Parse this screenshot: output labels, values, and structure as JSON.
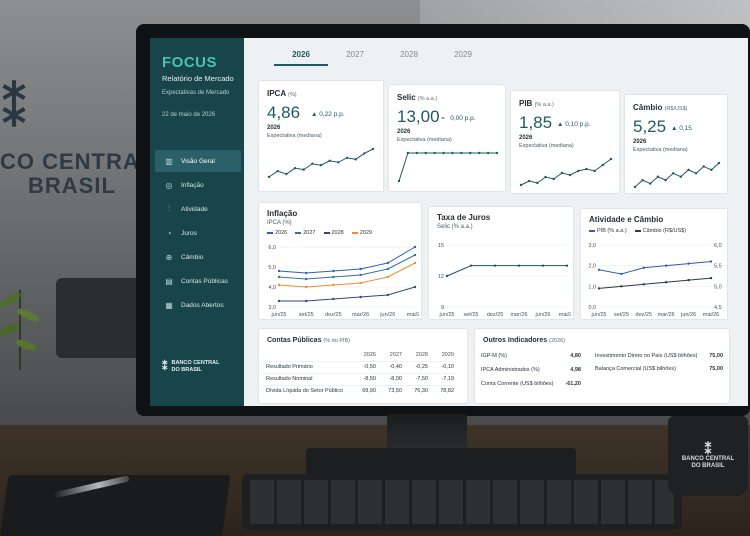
{
  "sidebar": {
    "brand": "FOCUS",
    "subtitle": "Relatório de Mercado",
    "description": "Expectativas de Mercado",
    "date": "22 de maio de 2026",
    "items": [
      {
        "label": "Visão Geral",
        "icon": "bar-chart-icon",
        "glyph": "▥",
        "active": true
      },
      {
        "label": "Inflação",
        "icon": "percent-icon",
        "glyph": "◎",
        "active": false
      },
      {
        "label": "Atividade",
        "icon": "activity-icon",
        "glyph": "⫶",
        "active": false
      },
      {
        "label": "Juros",
        "icon": "interest-icon",
        "glyph": "◔",
        "active": false
      },
      {
        "label": "Câmbio",
        "icon": "exchange-icon",
        "glyph": "⊕",
        "active": false
      },
      {
        "label": "Contas Públicas",
        "icon": "ledger-icon",
        "glyph": "▤",
        "active": false
      },
      {
        "label": "Dados Abertos",
        "icon": "database-icon",
        "glyph": "▦",
        "active": false
      }
    ],
    "logo_line1": "BANCO CENTRAL",
    "logo_line2": "DO BRASIL"
  },
  "tabs": [
    "2026",
    "2027",
    "2028",
    "2029"
  ],
  "active_tab": "2026",
  "kpis": [
    {
      "title": "IPCA",
      "unit": "(%)",
      "value": "4,86",
      "direction": "up",
      "change": "0,22 p.p.",
      "year": "2026",
      "expectation": "Expectativa (mediana)",
      "spark": [
        3.0,
        3.4,
        3.2,
        3.6,
        3.5,
        3.9,
        3.8,
        4.1,
        4.0,
        4.3,
        4.2,
        4.6,
        4.9
      ]
    },
    {
      "title": "Selic",
      "unit": "(% a.a.)",
      "value": "13,00",
      "direction": "flat",
      "change": "0,00 p.p.",
      "year": "2026",
      "expectation": "Expectativa (mediana)",
      "spark": [
        12.0,
        13.0,
        13.0,
        13.0,
        13.0,
        13.0,
        13.0,
        13.0,
        13.0,
        13.0,
        13.0,
        13.0
      ]
    },
    {
      "title": "PIB",
      "unit": "(% a.a.)",
      "value": "1,85",
      "direction": "up",
      "change": "0,10 p.p.",
      "year": "2026",
      "expectation": "Expectativa (mediana)",
      "spark": [
        1.2,
        1.3,
        1.25,
        1.4,
        1.35,
        1.5,
        1.45,
        1.55,
        1.6,
        1.55,
        1.7,
        1.85
      ]
    },
    {
      "title": "Câmbio",
      "unit": "(R$/US$)",
      "value": "5,25",
      "direction": "up",
      "change": "0,15",
      "year": "2026",
      "expectation": "Expectativa (mediana)",
      "spark": [
        4.9,
        5.0,
        4.95,
        5.05,
        5.0,
        5.1,
        5.05,
        5.15,
        5.1,
        5.2,
        5.15,
        5.25
      ]
    }
  ],
  "inflation_chart": {
    "title": "Inflação",
    "subtitle": "IPCA (%)",
    "legend": [
      "2026",
      "2027",
      "2028",
      "2029"
    ],
    "colors": [
      "#2f5fb3",
      "#3a6f9a",
      "#2b4a80",
      "#e8912e"
    ],
    "x_ticks": [
      "jun/25",
      "set/25",
      "dez/25",
      "mar/26",
      "jun/26",
      "mai/26"
    ],
    "y_ticks": [
      "6,0",
      "5,0",
      "4,0",
      "3,0"
    ]
  },
  "chart_data": [
    {
      "type": "line",
      "title": "Inflação",
      "ylabel": "IPCA (%)",
      "x": [
        "jun/25",
        "set/25",
        "dez/25",
        "mar/26",
        "jun/26",
        "mai/26"
      ],
      "ylim": [
        3.0,
        6.0
      ],
      "series": [
        {
          "name": "2026",
          "values": [
            4.8,
            4.7,
            4.8,
            4.9,
            5.2,
            6.0
          ]
        },
        {
          "name": "2027",
          "values": [
            4.5,
            4.4,
            4.5,
            4.6,
            4.9,
            5.6
          ]
        },
        {
          "name": "2028",
          "values": [
            3.3,
            3.3,
            3.4,
            3.5,
            3.6,
            4.0
          ]
        },
        {
          "name": "2029",
          "values": [
            4.1,
            4.0,
            4.1,
            4.2,
            4.5,
            5.2
          ]
        }
      ]
    },
    {
      "type": "line",
      "title": "Taxa de Juros",
      "ylabel": "Selic (% a.a.)",
      "x": [
        "jun/25",
        "set/25",
        "dez/25",
        "mar/26",
        "jun/26",
        "mai/26"
      ],
      "ylim": [
        9,
        15
      ],
      "series": [
        {
          "values": [
            12.0,
            13.0,
            13.0,
            13.0,
            13.0,
            13.0
          ]
        }
      ]
    },
    {
      "type": "line",
      "title": "Atividade e Câmbio",
      "x": [
        "jun/25",
        "set/25",
        "dez/25",
        "mar/26",
        "jun/26",
        "mai/26"
      ],
      "ylim": [
        0.0,
        3.0
      ],
      "y2lim": [
        4.5,
        6.0
      ],
      "series": [
        {
          "name": "PIB (% a.a.)",
          "axis": "left",
          "values": [
            1.8,
            1.6,
            1.9,
            2.0,
            2.1,
            2.2
          ]
        },
        {
          "name": "Câmbio (R$/US$)",
          "axis": "right",
          "values": [
            4.95,
            5.0,
            5.05,
            5.1,
            5.15,
            5.2
          ]
        }
      ]
    }
  ],
  "rates_chart": {
    "title": "Taxa de Juros",
    "subtitle": "Selic (% a.a.)",
    "x_ticks": [
      "jun/25",
      "set/25",
      "dez/25",
      "mar/26",
      "jun/26",
      "mai/26"
    ],
    "y_ticks": [
      "15",
      "12",
      "9"
    ]
  },
  "activity_chart": {
    "title": "Atividade e Câmbio",
    "legend": [
      "PIB (% a.a.)",
      "Câmbio (R$/US$)"
    ],
    "x_ticks": [
      "jun/25",
      "set/25",
      "dez/25",
      "mar/26",
      "jun/26",
      "mai/26"
    ],
    "y_ticks_left": [
      "3,0",
      "2,0",
      "1,0",
      "0,0"
    ],
    "y_ticks_right": [
      "6,0",
      "5,5",
      "5,0",
      "4,5"
    ]
  },
  "public_accounts": {
    "title": "Contas Públicas",
    "unit": "(% do PIB)",
    "columns": [
      "2026",
      "2027",
      "2028",
      "2029"
    ],
    "rows": [
      {
        "label": "Resultado Primário",
        "values": [
          "-0,50",
          "-0,40",
          "-0,25",
          "-0,10"
        ]
      },
      {
        "label": "Resultado Nominal",
        "values": [
          "-8,50",
          "-8,00",
          "-7,50",
          "-7,19"
        ]
      },
      {
        "label": "Dívida Líquida do Setor Público",
        "values": [
          "69,90",
          "73,50",
          "76,30",
          "78,82"
        ]
      }
    ]
  },
  "other_indicators": {
    "title": "Outros Indicadores",
    "year": "(2026)",
    "left": [
      {
        "label": "IGP-M (%)",
        "value": "4,80"
      },
      {
        "label": "IPCA Administrados (%)",
        "value": "4,98"
      },
      {
        "label": "Conta Corrente (US$ bilhões)",
        "value": "-61,20"
      }
    ],
    "right": [
      {
        "label": "Investimento Direto no País (US$ bilhões)",
        "value": "75,00"
      },
      {
        "label": "Balança Comercial (US$ bilhões)",
        "value": "75,00"
      }
    ]
  },
  "wall": {
    "line1": "CO CENTRAL",
    "line2": "BRASIL"
  },
  "mug": {
    "line1": "BANCO CENTRAL",
    "line2": "DO BRASIL"
  }
}
